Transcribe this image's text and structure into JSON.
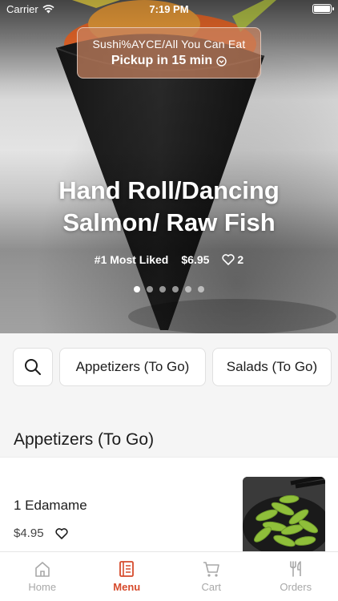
{
  "status_bar": {
    "carrier": "Carrier",
    "time": "7:19 PM"
  },
  "hero": {
    "store_name": "Sushi%AYCE/All You Can Eat",
    "pickup_text": "Pickup in 15 min",
    "title": "Hand Roll/Dancing Salmon/ Raw Fish",
    "rank": "#1 Most Liked",
    "price": "$6.95",
    "likes": "2",
    "carousel_count": 6,
    "carousel_active": 0
  },
  "categories": {
    "search_icon": "search-icon",
    "items": [
      "Appetizers (To Go)",
      "Salads (To Go)"
    ]
  },
  "section": {
    "title": "Appetizers (To Go)"
  },
  "menu_item": {
    "name": "1 Edamame",
    "price": "$4.95",
    "favorite_icon": "heart-icon"
  },
  "tabbar": {
    "items": [
      {
        "label": "Home",
        "icon": "home-icon"
      },
      {
        "label": "Menu",
        "icon": "menu-icon"
      },
      {
        "label": "Cart",
        "icon": "cart-icon"
      },
      {
        "label": "Orders",
        "icon": "orders-icon"
      }
    ],
    "active": 1
  },
  "colors": {
    "accent": "#d64b2c",
    "pickup_card": "#c8825f"
  }
}
